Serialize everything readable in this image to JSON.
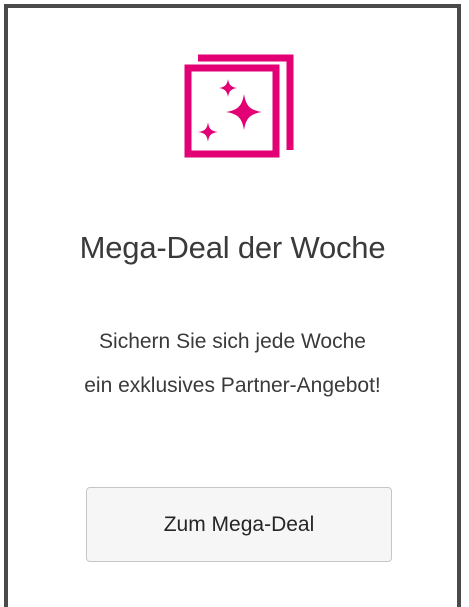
{
  "card": {
    "icon": "sparkles-stack-icon",
    "title": "Mega-Deal der Woche",
    "description_lines": [
      "Sichern Sie sich jede Woche",
      "ein exklusives Partner-Angebot!"
    ],
    "cta_label": "Zum Mega-Deal"
  },
  "colors": {
    "accent": "#e20074",
    "border": "#4a4a4a",
    "button_bg": "#f6f6f6"
  }
}
